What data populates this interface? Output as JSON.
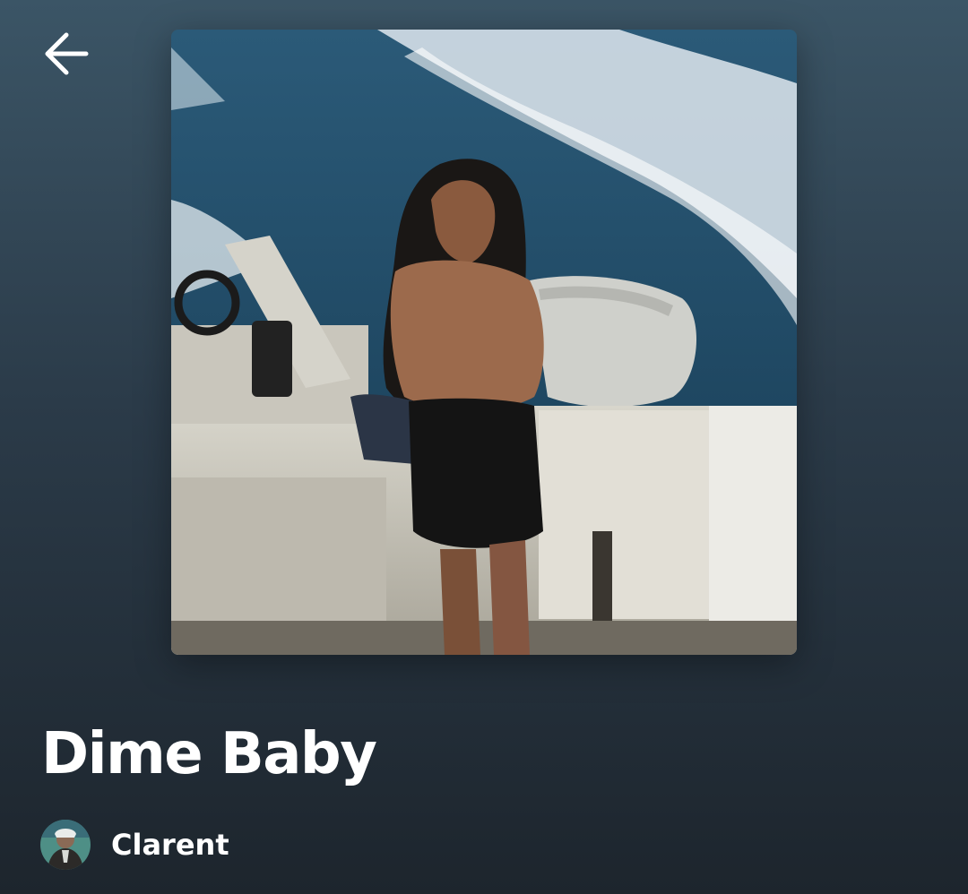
{
  "header": {
    "back_icon": "arrow-left-icon"
  },
  "album": {
    "title": "Dime Baby",
    "artist": "Clarent",
    "cover_icon": "album-cover-image",
    "avatar_icon": "artist-avatar-image"
  },
  "colors": {
    "background_top": "#3b5566",
    "background_bottom": "#1d252d",
    "text": "#ffffff"
  }
}
